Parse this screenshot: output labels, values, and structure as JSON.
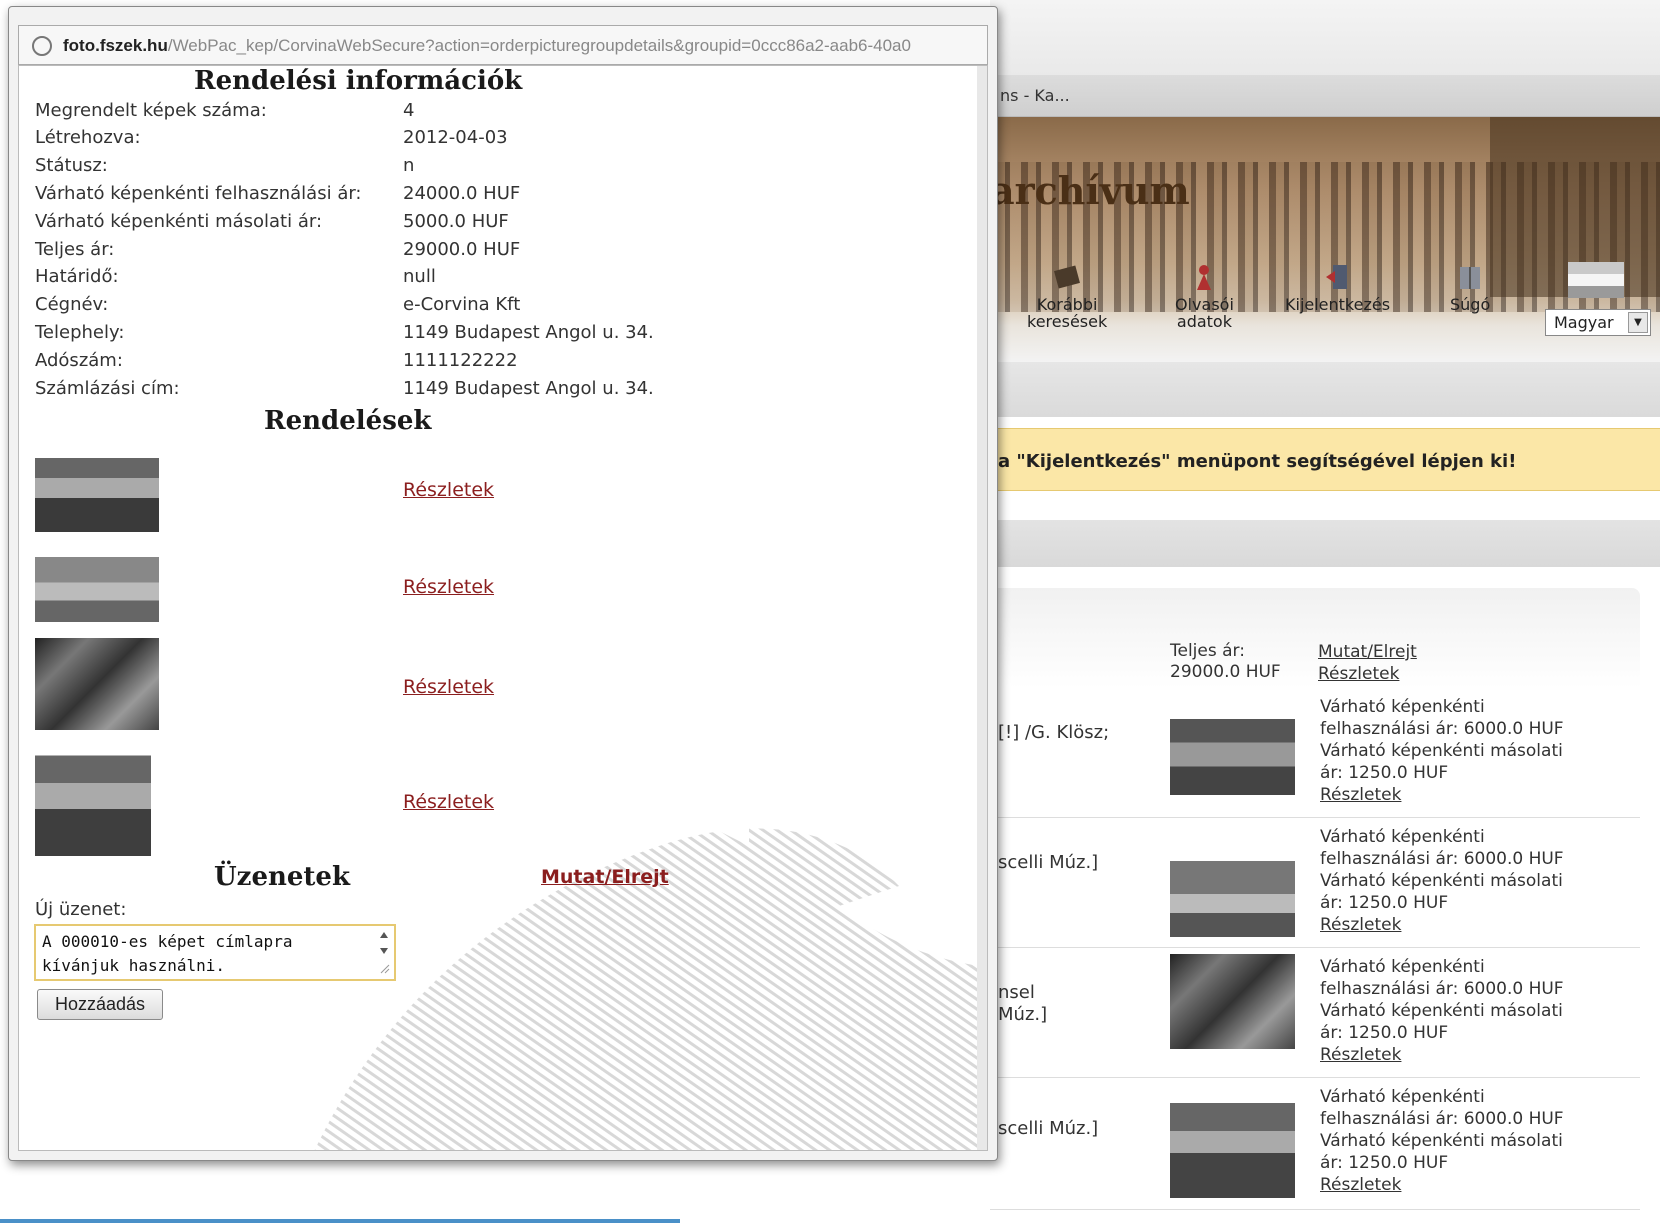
{
  "background_page": {
    "tab_title_fragment": "ns - Ka...",
    "banner_title_fragment": "archívum",
    "nav": [
      {
        "label_line1": "Korábbi",
        "label_line2": "keresések"
      },
      {
        "label_line1": "Olvasói",
        "label_line2": "adatok"
      },
      {
        "label_line1": "Kijelentkezés",
        "label_line2": ""
      },
      {
        "label_line1": "Súgó",
        "label_line2": ""
      }
    ],
    "language_select": "Magyar",
    "warning": "a \"Kijelentkezés\" menüpont segítségével lépjen ki!",
    "total_label": "Teljes ár:",
    "total_value": "29000.0 HUF",
    "show_hide": "Mutat/Elrejt",
    "details": "Részletek",
    "rows": [
      {
        "frag1": "[!] /G. Klösz;",
        "frag2": "",
        "line1": "Várható képenkénti",
        "line2": "felhasználási ár: 6000.0 HUF",
        "line3": "Várható képenkénti másolati",
        "line4": "ár: 1250.0 HUF",
        "link": "Részletek"
      },
      {
        "frag1": "scelli Múz.]",
        "frag2": "",
        "line1": "Várható képenkénti",
        "line2": "felhasználási ár: 6000.0 HUF",
        "line3": "Várható képenkénti másolati",
        "line4": "ár: 1250.0 HUF",
        "link": "Részletek"
      },
      {
        "frag1": "nsel",
        "frag2": "Múz.]",
        "line1": "Várható képenkénti",
        "line2": "felhasználási ár: 6000.0 HUF",
        "line3": "Várható képenkénti másolati",
        "line4": "ár: 1250.0 HUF",
        "link": "Részletek"
      },
      {
        "frag1": "scelli Múz.]",
        "frag2": "",
        "line1": "Várható képenkénti",
        "line2": "felhasználási ár: 6000.0 HUF",
        "line3": "Várható képenkénti másolati",
        "line4": "ár: 1250.0 HUF",
        "link": "Részletek"
      }
    ]
  },
  "popup": {
    "url_host": "foto.fszek.hu",
    "url_path": "/WebPac_kep/CorvinaWebSecure?action=orderpicturegroupdetails&groupid=0ccc86a2-aab6-40a0",
    "info_heading": "Rendelési információk",
    "info_rows": [
      {
        "label": "Megrendelt képek száma:",
        "value": "4"
      },
      {
        "label": "Létrehozva:",
        "value": "2012-04-03"
      },
      {
        "label": "Státusz:",
        "value": "n"
      },
      {
        "label": "Várható képenkénti felhasználási ár:",
        "value": "24000.0 HUF"
      },
      {
        "label": "Várható képenkénti másolati ár:",
        "value": "5000.0 HUF"
      },
      {
        "label": "Teljes ár:",
        "value": "29000.0 HUF"
      },
      {
        "label": "Határidő:",
        "value": "null"
      },
      {
        "label": "Cégnév:",
        "value": "e-Corvina Kft"
      },
      {
        "label": "Telephely:",
        "value": "1149 Budapest Angol u. 34."
      },
      {
        "label": "Adószám:",
        "value": "1111122222"
      },
      {
        "label": "Számlázási cím:",
        "value": "1149 Budapest Angol u. 34."
      }
    ],
    "orders_heading": "Rendelések",
    "orders": [
      {
        "link": "Részletek"
      },
      {
        "link": "Részletek"
      },
      {
        "link": "Részletek"
      },
      {
        "link": "Részletek"
      }
    ],
    "messages_heading": "Üzenetek",
    "messages_toggle": "Mutat/Elrejt",
    "new_message_label": "Új üzenet:",
    "new_message_value_line1": "A 000010-es képet címlapra",
    "new_message_value_line2": "kívánjuk használni.",
    "add_button": "Hozzáadás"
  }
}
